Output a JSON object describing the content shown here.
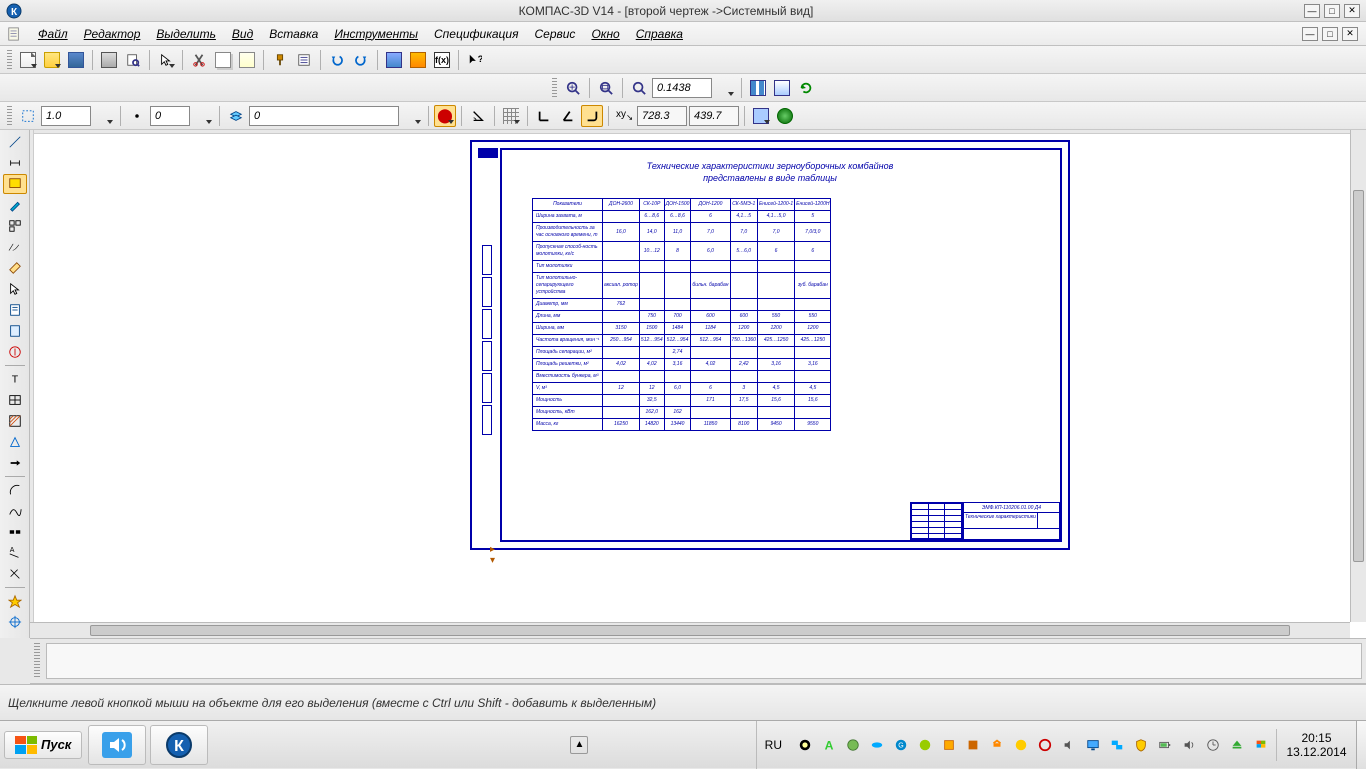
{
  "title_bar": {
    "text": "КОМПАС-3D V14 - [второй чертеж ->Системный вид]"
  },
  "menu": {
    "items": [
      "Файл",
      "Редактор",
      "Выделить",
      "Вид",
      "Вставка",
      "Инструменты",
      "Спецификация",
      "Сервис",
      "Окно",
      "Справка"
    ]
  },
  "toolbar_ctx": {
    "zoom_value": "0.1438",
    "style_dd": "1.0",
    "num_field": "0",
    "layer_field": "0",
    "coord_x": "728.3",
    "coord_y": "439.7"
  },
  "drawing": {
    "title_line1": "Технические характеристики зерноуборочных комбайнов",
    "title_line2": "представлены в виде таблицы",
    "columns": [
      "Показатели",
      "ДОН-2600",
      "СК-10Р",
      "ДОН-1500",
      "ДОН-1200",
      "СК-5МЭ-1",
      "Енисей-1200-1",
      "Енисей-1200Н"
    ],
    "rows": [
      {
        "param": "Ширина захвата, м",
        "v": [
          "",
          "6…8,6",
          "6…8,6",
          "6",
          "4,1…5",
          "4,1…5,0",
          "5"
        ]
      },
      {
        "param": "Производительность за час основного времени, т",
        "v": [
          "16,0",
          "14,0",
          "11,0",
          "7,0",
          "7,0",
          "7,0",
          "7,0/3,0"
        ]
      },
      {
        "param": "Пропускная способ-ность молотилки, кг/с",
        "v": [
          "",
          "10…12",
          "8",
          "6,0",
          "5…6,0",
          "6",
          "6"
        ]
      },
      {
        "param": "Тип молотилки",
        "v": [
          "",
          "",
          "",
          "",
          "",
          "",
          ""
        ]
      },
      {
        "param": "Тип молотильно-сепарирующего устройства",
        "v": [
          "аксиал. ротор",
          "",
          "",
          "бильн. барабан",
          "",
          "",
          "зуб. барабан"
        ]
      },
      {
        "param": "Диаметр, мм",
        "v": [
          "762",
          "",
          "",
          "",
          "",
          "",
          ""
        ]
      },
      {
        "param": "Длина, мм",
        "v": [
          "",
          "750",
          "700",
          "600",
          "600",
          "550",
          "550"
        ]
      },
      {
        "param": "Ширина, мм",
        "v": [
          "3150",
          "1500",
          "1484",
          "1184",
          "1200",
          "1200",
          "1200"
        ]
      },
      {
        "param": "Частота вращения, мин⁻¹",
        "v": [
          "250…954",
          "512…954",
          "512…954",
          "512…954",
          "750…1360",
          "425…1250",
          "425…1250"
        ]
      },
      {
        "param": "Площадь сепарации, м²",
        "v": [
          "",
          "",
          "2,74",
          "",
          "",
          "",
          ""
        ]
      },
      {
        "param": "Площадь решетки, м²",
        "v": [
          "4,02",
          "4,02",
          "3,16",
          "4,02",
          "2,42",
          "3,16",
          "3,16"
        ]
      },
      {
        "param": "Вместимость бункера, м³",
        "v": [
          "",
          "",
          "",
          "",
          "",
          "",
          ""
        ]
      },
      {
        "param": "V, м³",
        "v": [
          "12",
          "12",
          "6,0",
          "6",
          "3",
          "4,5",
          "4,5"
        ]
      },
      {
        "param": "Мощность",
        "v": [
          "",
          "32,5",
          "",
          "171",
          "17,5",
          "15,6",
          "15,6"
        ]
      },
      {
        "param": "Мощность, кВт",
        "v": [
          "",
          "162,0",
          "162",
          "",
          "",
          "",
          ""
        ]
      },
      {
        "param": "Масса, кг",
        "v": [
          "16250",
          "14820",
          "13440",
          "11850",
          "8100",
          "9450",
          "9550"
        ]
      }
    ],
    "stamp": {
      "doc_number": "ЭМФ.КП-110206.01.00 Д4",
      "doc_title": "Технические\nхарактеристики"
    }
  },
  "status": {
    "hint": "Щелкните левой кнопкой мыши на объекте для его выделения (вместе с Ctrl или Shift - добавить к выделенным)"
  },
  "taskbar": {
    "start": "Пуск",
    "lang": "RU",
    "time": "20:15",
    "date": "13.12.2014"
  }
}
